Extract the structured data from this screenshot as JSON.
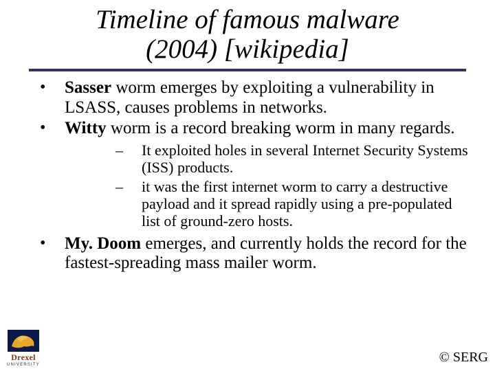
{
  "title_line1": "Timeline of famous malware",
  "title_line2": "(2004) [wikipedia]",
  "bullets": {
    "b1_bold": "Sasser",
    "b1_rest": " worm emerges by exploiting a vulnerability in LSASS, causes problems in networks.",
    "b2_bold": "Witty",
    "b2_rest": " worm is a record breaking worm in many regards.",
    "b2_sub1": "It exploited holes in several Internet Security Systems (ISS) products.",
    "b2_sub2": "it was the first internet worm to carry a destructive payload and it spread rapidly using a pre-populated list of ground-zero hosts.",
    "b3_bold": "My. Doom",
    "b3_rest": " emerges, and currently holds the record for the fastest-spreading mass mailer worm."
  },
  "footer": "© SERG",
  "logo": {
    "name": "Drexel",
    "sub": "UNIVERSITY"
  }
}
